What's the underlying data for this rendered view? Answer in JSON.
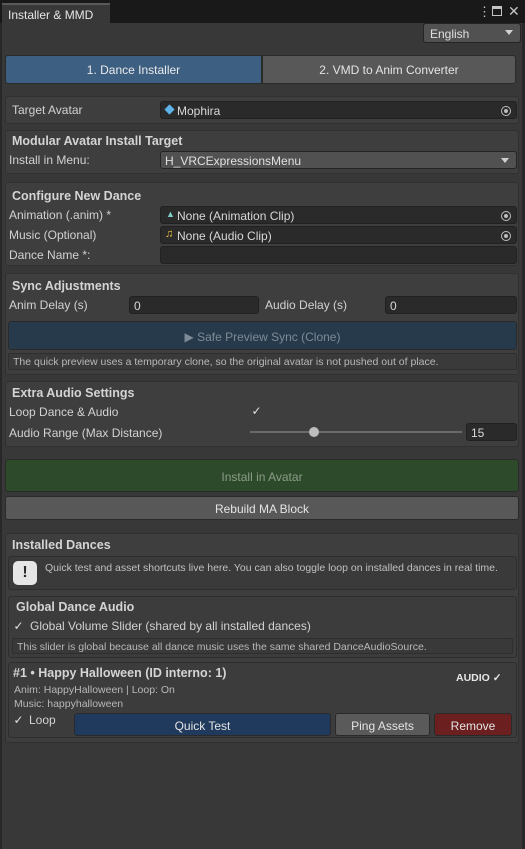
{
  "window": {
    "tab_title": "Installer & MMD",
    "menu_icon": "kebab-menu-icon",
    "maximize_icon": "maximize-icon",
    "close_icon": "close-icon"
  },
  "language": {
    "selected": "English"
  },
  "tabs": [
    {
      "label": "1. Dance Installer",
      "active": true
    },
    {
      "label": "2. VMD to Anim Converter",
      "active": false
    }
  ],
  "target_avatar": {
    "label": "Target Avatar",
    "value": "Mophira",
    "icon": "cube-icon"
  },
  "ma_target": {
    "title": "Modular Avatar Install Target",
    "menu_label": "Install in Menu:",
    "menu_value": "H_VRCExpressionsMenu"
  },
  "new_dance": {
    "title": "Configure New Dance",
    "animation_label": "Animation (.anim) *",
    "animation_value": "None (Animation Clip)",
    "music_label": "Music (Optional)",
    "music_value": "None (Audio Clip)",
    "name_label": "Dance Name *:",
    "name_value": ""
  },
  "sync": {
    "title": "Sync Adjustments",
    "anim_delay_label": "Anim Delay (s)",
    "anim_delay_value": "0",
    "audio_delay_label": "Audio Delay (s)",
    "audio_delay_value": "0",
    "preview_button": "▶ Safe Preview Sync (Clone)",
    "preview_note": "The quick preview uses a temporary clone, so the original avatar is not pushed out of place."
  },
  "extra_audio": {
    "title": "Extra Audio Settings",
    "loop_label": "Loop Dance & Audio",
    "loop_checked": true,
    "range_label": "Audio Range (Max Distance)",
    "range_value": "15",
    "range_fraction": 0.3
  },
  "actions": {
    "install_button": "Install in Avatar",
    "rebuild_button": "Rebuild MA Block"
  },
  "installed": {
    "title": "Installed Dances",
    "info_text": "Quick test and asset shortcuts live here. You can also toggle loop on installed dances in real time.",
    "global_title": "Global Dance Audio",
    "global_slider_label": "Global Volume Slider (shared by all installed dances)",
    "global_note": "This slider is global because all dance music uses the same shared DanceAudioSource.",
    "dances": [
      {
        "title": "#1 • Happy Halloween  (ID interno: 1)",
        "audio_badge": "AUDIO ✓",
        "meta_line1": "Anim: HappyHalloween | Loop: On",
        "meta_line2": "Music: happyhalloween",
        "loop_label": "Loop",
        "quick_test": "Quick Test",
        "ping_assets": "Ping Assets",
        "remove": "Remove"
      }
    ]
  },
  "colors": {
    "active_tab": "#3d5f82",
    "install_button": "#2d4a2b",
    "preview_button": "#273a4b",
    "quick_test": "#1f3a5c",
    "remove": "#6b1f1f"
  }
}
